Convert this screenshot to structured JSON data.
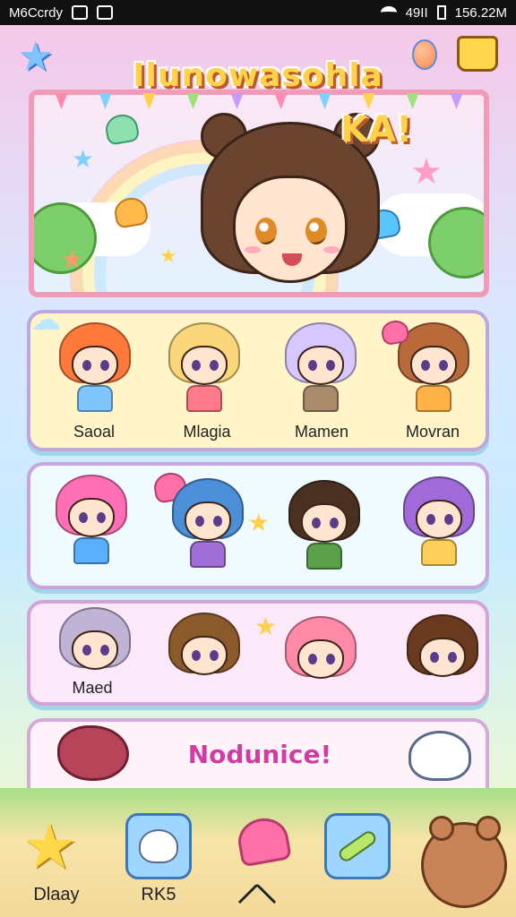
{
  "status_bar": {
    "carrier": "M6Ccrdy",
    "battery": "49II",
    "time": "156.22M"
  },
  "banner": {
    "title": "Ilunowasohla",
    "subtitle": "KA!"
  },
  "characters": {
    "row1": [
      {
        "name": "Saoal",
        "hair": "#ff7a3a",
        "shirt": "#7fc6ff"
      },
      {
        "name": "Mlagia",
        "hair": "#f9d77a",
        "shirt": "#ff7a8a"
      },
      {
        "name": "Mamen",
        "hair": "#d6c8ff",
        "shirt": "#a98a6a"
      },
      {
        "name": "Movran",
        "hair": "#b86a3a",
        "shirt": "#ffb347"
      }
    ],
    "row2": [
      {
        "name": "",
        "hair": "#ff6fb5",
        "shirt": "#5ab0ff"
      },
      {
        "name": "",
        "hair": "#4a8fd8",
        "shirt": "#a070d8"
      },
      {
        "name": "",
        "hair": "#4a3020",
        "shirt": "#5aa04a"
      },
      {
        "name": "",
        "hair": "#a06ad8",
        "shirt": "#ffcf5a"
      }
    ],
    "row3": [
      {
        "name": "Maed",
        "hair": "#bfb3d6",
        "shirt": "#5ab07a"
      },
      {
        "name": "",
        "hair": "#8a5a2a",
        "shirt": "#ffd24a"
      },
      {
        "name": "",
        "hair": "#ff8aa8",
        "shirt": "#ff8aa8"
      },
      {
        "name": "",
        "hair": "#6a3a20",
        "shirt": "#d88a5a"
      }
    ]
  },
  "message": "Nodunice!",
  "nav": {
    "left_label": "Dlaay",
    "second_label": "RK5"
  },
  "colors": {
    "accent_pink": "#f29ab8",
    "title_yellow": "#ffd24a",
    "title_outline": "#b85a2a",
    "message_magenta": "#d43aa3"
  }
}
